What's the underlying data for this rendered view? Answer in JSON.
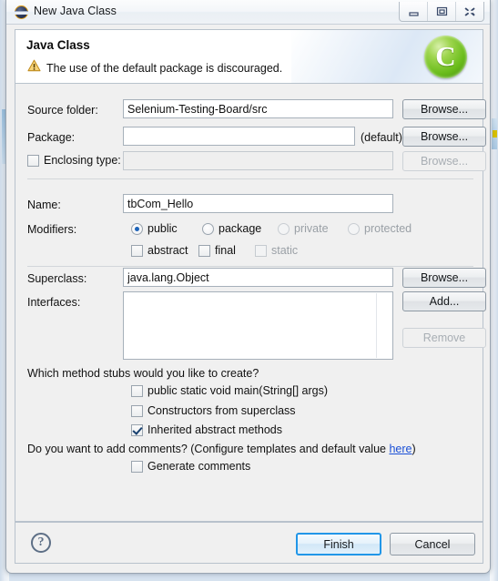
{
  "window": {
    "title": "New Java Class",
    "icon": "eclipse-disc-icon",
    "controls": {
      "minimize": "minimize-icon",
      "restore": "restore-icon",
      "close": "close-icon"
    }
  },
  "banner": {
    "title": "Java Class",
    "message": "The use of the default package is discouraged.",
    "message_icon": "warning-icon",
    "logo": "C",
    "logo_name": "java-class-wizard-logo"
  },
  "form": {
    "source_folder": {
      "label": "Source folder:",
      "value": "Selenium-Testing-Board/src",
      "browse": "Browse..."
    },
    "package": {
      "label": "Package:",
      "value": "",
      "hint": "(default)",
      "browse": "Browse..."
    },
    "enclosing_type": {
      "label": "Enclosing type:",
      "checked": false,
      "value": "",
      "browse": "Browse...",
      "disabled": true
    },
    "name": {
      "label": "Name:",
      "value": "tbCom_Hello"
    },
    "modifiers": {
      "label": "Modifiers:",
      "radios": [
        {
          "label": "public",
          "selected": true,
          "disabled": false
        },
        {
          "label": "package",
          "selected": false,
          "disabled": false
        },
        {
          "label": "private",
          "selected": false,
          "disabled": true
        },
        {
          "label": "protected",
          "selected": false,
          "disabled": true
        }
      ],
      "checks": [
        {
          "label": "abstract",
          "checked": false,
          "disabled": false
        },
        {
          "label": "final",
          "checked": false,
          "disabled": false
        },
        {
          "label": "static",
          "checked": false,
          "disabled": true
        }
      ]
    },
    "superclass": {
      "label": "Superclass:",
      "value": "java.lang.Object",
      "browse": "Browse..."
    },
    "interfaces": {
      "label": "Interfaces:",
      "items": [],
      "add": "Add...",
      "remove": "Remove",
      "remove_disabled": true
    }
  },
  "stubs": {
    "question": "Which method stubs would you like to create?",
    "options": [
      {
        "label": "public static void main(String[] args)",
        "checked": false
      },
      {
        "label": "Constructors from superclass",
        "checked": false
      },
      {
        "label": "Inherited abstract methods",
        "checked": true
      }
    ]
  },
  "comments": {
    "question_before": "Do you want to add comments? (Configure templates and default value ",
    "link": "here",
    "question_after": ")",
    "option": {
      "label": "Generate comments",
      "checked": false
    }
  },
  "footer": {
    "help": "?",
    "finish": "Finish",
    "cancel": "Cancel"
  },
  "colors": {
    "accent_focus": "#2196e8",
    "link": "#1a4fd6",
    "logo_green": "#6bbd1c",
    "warning_amber": "#e8b23a",
    "dialog_bg": "#f0f0f0"
  }
}
